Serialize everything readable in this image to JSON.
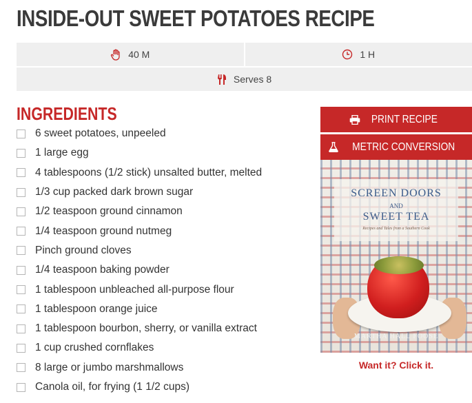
{
  "title": "INSIDE-OUT SWEET POTATOES RECIPE",
  "meta": {
    "prep_time": "40 M",
    "total_time": "1 H",
    "serves": "Serves 8"
  },
  "ingredients": {
    "heading": "INGREDIENTS",
    "items": [
      "6 sweet potatoes, unpeeled",
      "1 large egg",
      "4 tablespoons (1/2 stick) unsalted butter, melted",
      "1/3 cup packed dark brown sugar",
      "1/2 teaspoon ground cinnamon",
      "1/4 teaspoon ground nutmeg",
      "Pinch ground cloves",
      "1/4 teaspoon baking powder",
      "1 tablespoon unbleached all-purpose flour",
      "1 tablespoon orange juice",
      "1 tablespoon bourbon, sherry, or vanilla extract",
      "1 cup crushed cornflakes",
      "8 large or jumbo marshmallows",
      "Canola oil, for frying (1 1/2 cups)"
    ]
  },
  "sidebar": {
    "print_label": "PRINT RECIPE",
    "metric_label": "METRIC CONVERSION",
    "book": {
      "title_line1": "SCREEN DOORS",
      "title_and": "AND",
      "title_line2": "SWEET TEA",
      "subtitle": "Recipes and Tales from a Southern Cook",
      "author": "MARTHA HALL FOOSE"
    },
    "cta": "Want it? Click it."
  },
  "colors": {
    "accent": "#c62828",
    "meta_bg": "#efefef",
    "text": "#333333"
  },
  "icons": {
    "prep": "hand-icon",
    "total": "clock-icon",
    "serves": "utensils-icon",
    "print": "printer-icon",
    "metric": "flask-icon"
  }
}
